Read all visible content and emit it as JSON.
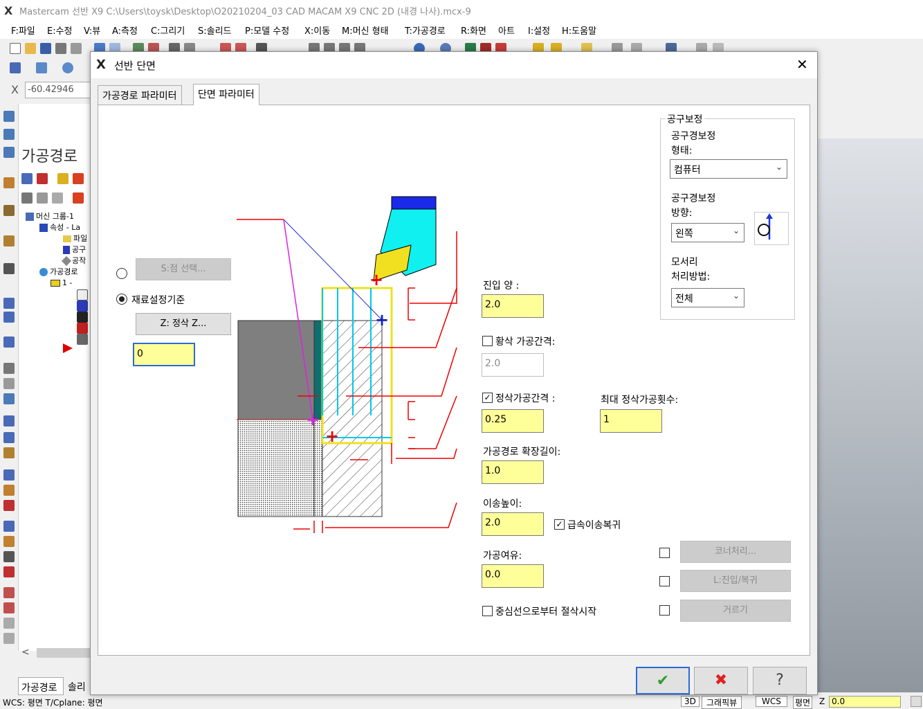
{
  "app": {
    "title": "Mastercam 선반 X9  C:\\Users\\toysk\\Desktop\\O20210204_03 CAD MACAM X9 CNC 2D (내경 나사).mcx-9"
  },
  "menu": [
    "F:파일",
    "E:수정",
    "V:뷰",
    "A:측정",
    "C:그리기",
    "S:솔리드",
    "P:모델 수정",
    "X:이동",
    "M:머신 형태",
    "T:가공경로",
    "R:화면",
    "아트",
    "I:설정",
    "H:도움말"
  ],
  "coord": {
    "axis": "X",
    "value": "-60.42946"
  },
  "manager": {
    "title": "가공경로",
    "tree": [
      "머신 그룹-1",
      "속성 - La",
      "파일",
      "공구",
      "공작",
      "가공경로",
      "1 -"
    ],
    "bottom_tabs": [
      "가공경로",
      "솔리"
    ]
  },
  "status": {
    "left": "WCS: 평면  T/Cplane: 평면",
    "items": [
      "3D",
      "그래픽뷰",
      "WCS",
      "평면",
      "Z",
      "0.0"
    ]
  },
  "dialog": {
    "title": "선반 단면",
    "tabs": [
      "가공경로 파라미터",
      "단면 파라미터"
    ],
    "point_select_btn": "S:점 선택...",
    "stock_ref_label": "재료설정기준",
    "finish_z_btn": "Z: 정삭 Z...",
    "z_value": "0",
    "entry_amount": {
      "label": "진입 양 :",
      "value": "2.0"
    },
    "rough_step": {
      "label": "황삭 가공간격:",
      "value": "2.0",
      "checked": false
    },
    "finish_step": {
      "label": "정삭가공간격 :",
      "value": "0.25",
      "checked": true
    },
    "max_finish_passes": {
      "label": "최대 정삭가공횟수:",
      "value": "1"
    },
    "overcut": {
      "label": "가공경로 확장길이:",
      "value": "1.0"
    },
    "retract": {
      "label": "이송높이:",
      "value": "2.0"
    },
    "rapid_retract": {
      "label": "급속이송복귀",
      "checked": true
    },
    "stock_to_leave": {
      "label": "가공여유:",
      "value": "0.0"
    },
    "cut_from_center": {
      "label": "중심선으로부터 절삭시작",
      "checked": false
    },
    "comp": {
      "group_label": "공구보정",
      "type_label_1": "공구경보정",
      "type_label_2": "형태:",
      "type_value": "컴퓨터",
      "dir_label_1": "공구경보정",
      "dir_label_2": "방향:",
      "dir_value": "왼쪽",
      "corner_label_1": "모서리",
      "corner_label_2": "처리방법:",
      "corner_value": "전체"
    },
    "corner_btn": "코너처리...",
    "leadin_btn": "L:진입/복귀",
    "filter_btn": "거르기",
    "colors": {
      "input_bg": "#ffff99",
      "ok": "#2e9e2e",
      "cancel": "#e02020"
    }
  }
}
